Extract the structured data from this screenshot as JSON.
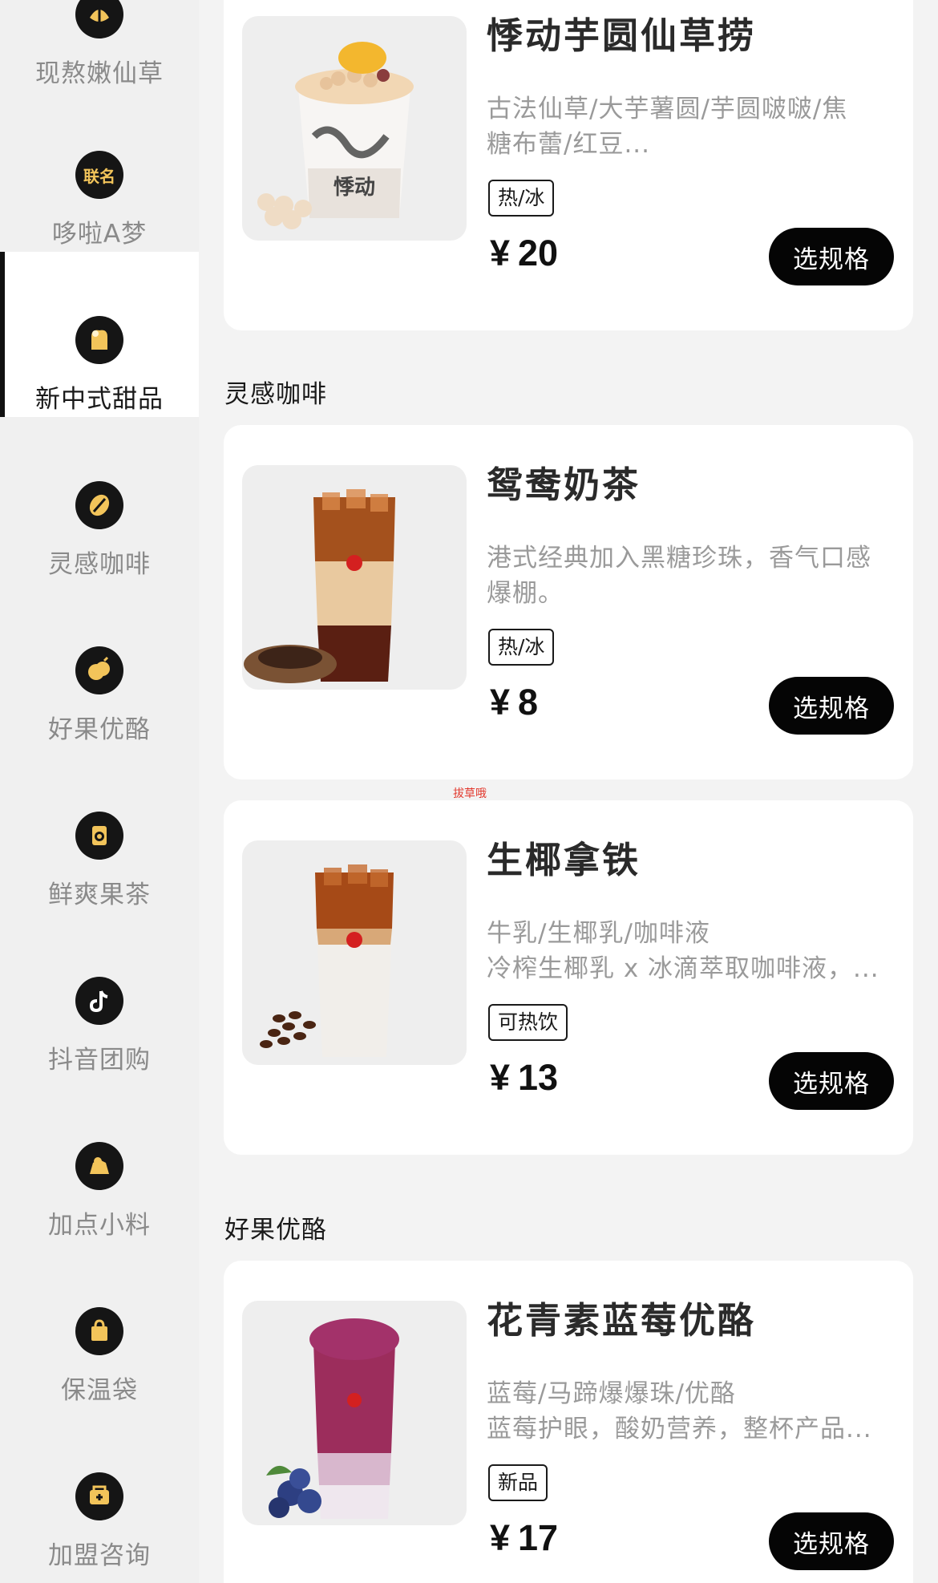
{
  "sidebar": {
    "items": [
      {
        "label": "现熬嫩仙草",
        "icon": "grass-jelly-icon"
      },
      {
        "label": "哆啦A梦",
        "icon": "co-brand-icon",
        "badge": "联名"
      },
      {
        "label": "新中式甜品",
        "icon": "dessert-icon"
      },
      {
        "label": "灵感咖啡",
        "icon": "coffee-bean-icon"
      },
      {
        "label": "好果优酪",
        "icon": "fruit-yogurt-icon"
      },
      {
        "label": "鲜爽果茶",
        "icon": "fruit-tea-icon"
      },
      {
        "label": "抖音团购",
        "icon": "tiktok-icon"
      },
      {
        "label": "加点小料",
        "icon": "toppings-icon"
      },
      {
        "label": "保温袋",
        "icon": "bag-icon"
      },
      {
        "label": "加盟咨询",
        "icon": "franchise-icon"
      }
    ],
    "active_index": 2
  },
  "sections": [
    {
      "title": "灵感咖啡"
    },
    {
      "title": "好果优酪"
    }
  ],
  "products": [
    {
      "name": "悸动芋圆仙草捞",
      "desc_line1": "古法仙草/大芋薯圆/芋圆啵啵/焦",
      "desc_line2": "糖布蕾/红豆...",
      "tag": "热/冰",
      "currency": "¥",
      "price": "20",
      "button": "选规格",
      "cup_text": "悸动"
    },
    {
      "name": "鸳鸯奶茶",
      "desc_line1": "港式经典加入黑糖珍珠，香气口感",
      "desc_line2": "爆棚。",
      "tag": "热/冰",
      "currency": "¥",
      "price": "8",
      "button": "选规格"
    },
    {
      "name": "生椰拿铁",
      "desc_line1": "牛乳/生椰乳/咖啡液",
      "desc_line2": "冷榨生椰乳 x 冰滴萃取咖啡液，...",
      "tag": "可热饮",
      "currency": "¥",
      "price": "13",
      "button": "选规格"
    },
    {
      "name": "花青素蓝莓优酪",
      "desc_line1": "蓝莓/马蹄爆爆珠/优酪",
      "desc_line2": "蓝莓护眼，酸奶营养，整杯产品...",
      "tag": "新品",
      "currency": "¥",
      "price": "17",
      "button": "选规格"
    }
  ],
  "watermark": "拔草哦",
  "colors": {
    "accent": "#050505",
    "icon_gold": "#f2c45a",
    "background": "#f3f3f3"
  }
}
